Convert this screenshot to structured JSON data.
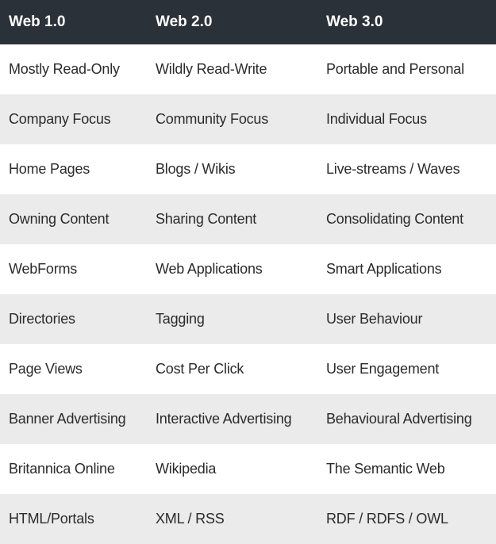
{
  "table": {
    "headers": [
      "Web 1.0",
      "Web 2.0",
      "Web 3.0"
    ],
    "rows": [
      [
        "Mostly Read-Only",
        "Wildly Read-Write",
        "Portable and Personal"
      ],
      [
        "Company Focus",
        "Community Focus",
        "Individual Focus"
      ],
      [
        "Home Pages",
        "Blogs / Wikis",
        "Live-streams / Waves"
      ],
      [
        "Owning Content",
        "Sharing Content",
        "Consolidating Content"
      ],
      [
        "WebForms",
        "Web Applications",
        "Smart Applications"
      ],
      [
        "Directories",
        "Tagging",
        "User Behaviour"
      ],
      [
        "Page Views",
        "Cost Per Click",
        "User Engagement"
      ],
      [
        "Banner Advertising",
        "Interactive Advertising",
        "Behavioural Advertising"
      ],
      [
        "Britannica Online",
        "Wikipedia",
        "The Semantic Web"
      ],
      [
        "HTML/Portals",
        "XML / RSS",
        "RDF / RDFS / OWL"
      ]
    ]
  },
  "colors": {
    "header_bg": "#2a3139",
    "header_text": "#ffffff",
    "row_alt_bg": "#ebebeb",
    "row_bg": "#ffffff",
    "body_text": "#2b2b2b"
  }
}
